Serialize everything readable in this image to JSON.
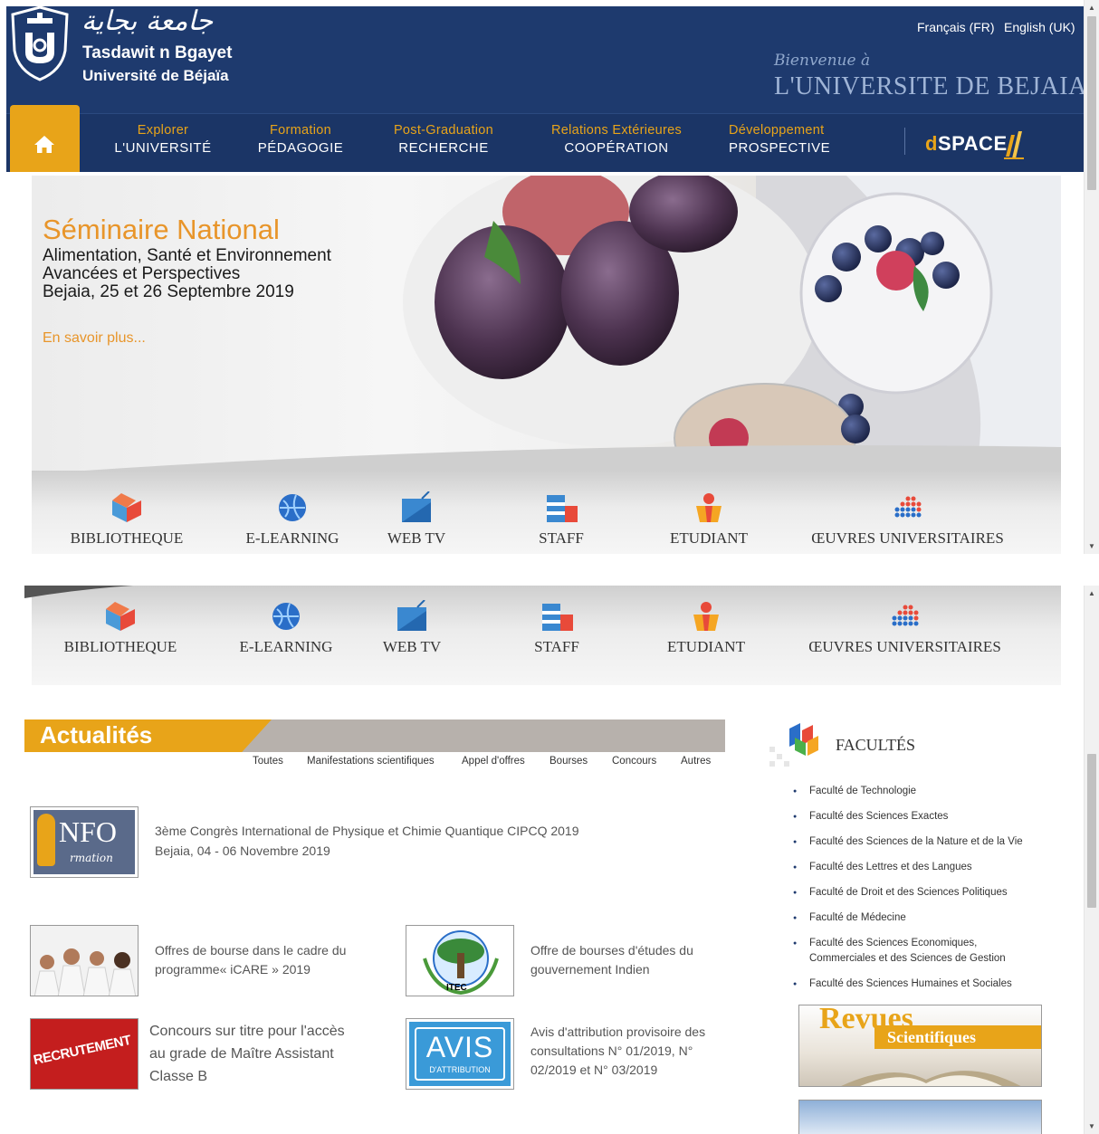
{
  "header": {
    "arabic_name": "جامعة بجاية",
    "name_line1": "Tasdawit n Bgayet",
    "name_line2": "Université de Béjaïa",
    "welcome_line1": "Bienvenue à",
    "welcome_line2": "L'UNIVERSITE DE BEJAIA",
    "languages": [
      "Français (FR)",
      "English (UK)"
    ]
  },
  "nav": {
    "items": [
      {
        "top": "Explorer",
        "bottom": "L'UNIVERSITÉ"
      },
      {
        "top": "Formation",
        "bottom": "PÉDAGOGIE"
      },
      {
        "top": "Post-Graduation",
        "bottom": "RECHERCHE"
      },
      {
        "top": "Relations Extérieures",
        "bottom": "COOPÉRATION"
      },
      {
        "top": "Développement",
        "bottom": "PROSPECTIVE"
      }
    ],
    "dspace_d": "d",
    "dspace_rest": "SPACE"
  },
  "banner": {
    "title": "Séminaire National",
    "line1": "Alimentation, Santé et Environnement",
    "line2": "Avancées et Perspectives",
    "line3": "Bejaia, 25 et 26 Septembre 2019",
    "more": "En savoir plus..."
  },
  "quicklinks": [
    "BIBLIOTHEQUE",
    "E-LEARNING",
    "WEB TV",
    "STAFF",
    "ETUDIANT",
    "ŒUVRES UNIVERSITAIRES"
  ],
  "news": {
    "title": "Actualités",
    "filters": [
      "Toutes",
      "Manifestations scientifiques",
      "Appel d'offres",
      "Bourses",
      "Concours",
      "Autres"
    ],
    "items": [
      {
        "badge_main": "NFO",
        "badge_sub": "rmation",
        "text1": "3ème Congrès International de Physique et Chimie Quantique CIPCQ 2019",
        "text2": "Bejaia, 04 - 06 Novembre 2019"
      },
      {
        "text1": "Offres de bourse dans le cadre du",
        "text2": "programme« iCARE » 2019"
      },
      {
        "badge": "ITEC",
        "text1": "Offre de bourses d'études du",
        "text2": "gouvernement Indien"
      },
      {
        "badge": "RECRUTEMENT",
        "text1": "Concours sur titre pour l'accès",
        "text2": "au grade de Maître Assistant",
        "text3": "Classe B"
      },
      {
        "badge_main": "AVIS",
        "badge_sub": "D'ATTRIBUTION",
        "text1": "Avis d'attribution provisoire des",
        "text2": "consultations N° 01/2019, N°",
        "text3": "02/2019 et N° 03/2019"
      }
    ]
  },
  "faculties": {
    "title": "FACULTÉS",
    "items": [
      "Faculté de Technologie",
      "Faculté des Sciences Exactes",
      "Faculté des Sciences de la Nature et de la Vie",
      "Faculté des Lettres et des Langues",
      "Faculté de Droit et des Sciences Politiques",
      "Faculté de Médecine",
      "Faculté des Sciences Economiques, Commerciales et des Sciences de Gestion",
      "Faculté des Sciences Humaines et Sociales"
    ]
  },
  "revues": {
    "line1": "Revues",
    "line2": "Scientifiques"
  },
  "colors": {
    "navy": "#1e3a6e",
    "orange": "#e8a419"
  }
}
